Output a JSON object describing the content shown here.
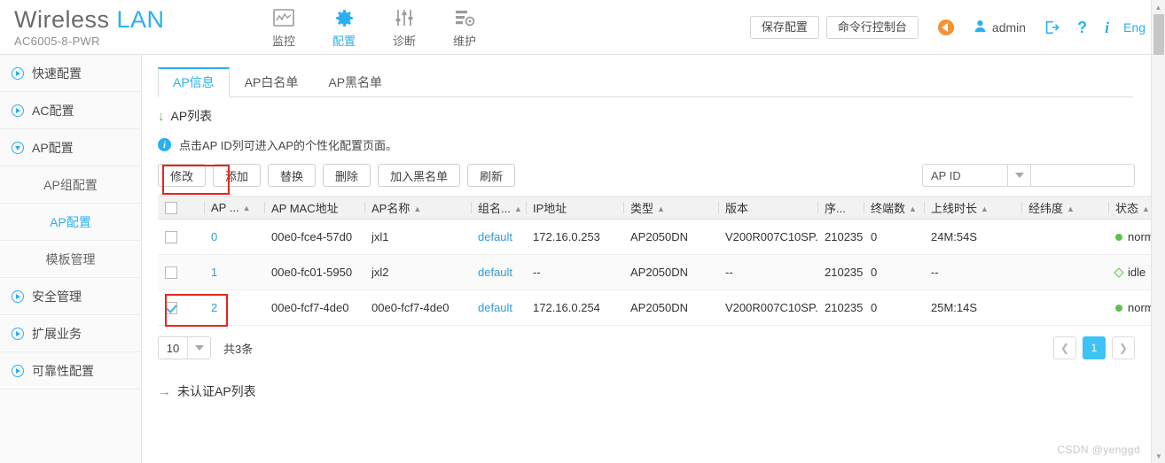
{
  "header": {
    "brand_main": "Wireless",
    "brand_accent": "LAN",
    "brand_sub": "AC6005-8-PWR",
    "nav": [
      {
        "label": "监控",
        "icon": "monitor-chart-icon",
        "active": false
      },
      {
        "label": "配置",
        "icon": "gear-icon",
        "active": true
      },
      {
        "label": "诊断",
        "icon": "sliders-icon",
        "active": false
      },
      {
        "label": "维护",
        "icon": "server-gear-icon",
        "active": false
      }
    ],
    "save_config_label": "保存配置",
    "cli_console_label": "命令行控制台",
    "alarm_icon": "alarm-megaphone-icon",
    "user_icon": "user-icon",
    "user_name": "admin",
    "logout_icon": "logout-icon",
    "help_icon": "question-mark-icon",
    "info_icon": "info-icon",
    "language_label": "Eng"
  },
  "sidebar": {
    "items": [
      {
        "label": "快速配置",
        "type": "group",
        "expanded": false,
        "active": false
      },
      {
        "label": "AC配置",
        "type": "group",
        "expanded": false,
        "active": false
      },
      {
        "label": "AP配置",
        "type": "group",
        "expanded": true,
        "active": false
      },
      {
        "label": "AP组配置",
        "type": "sub",
        "active": false
      },
      {
        "label": "AP配置",
        "type": "sub",
        "active": true
      },
      {
        "label": "模板管理",
        "type": "sub",
        "active": false
      },
      {
        "label": "安全管理",
        "type": "group",
        "expanded": false,
        "active": false
      },
      {
        "label": "扩展业务",
        "type": "group",
        "expanded": false,
        "active": false
      },
      {
        "label": "可靠性配置",
        "type": "group",
        "expanded": false,
        "active": false
      }
    ]
  },
  "main": {
    "tabs": [
      {
        "label": "AP信息",
        "active": true
      },
      {
        "label": "AP白名单",
        "active": false
      },
      {
        "label": "AP黑名单",
        "active": false
      }
    ],
    "section_title": "AP列表",
    "info_message": "点击AP ID列可进入AP的个性化配置页面。",
    "toolbar": [
      {
        "label": "修改",
        "highlighted": true
      },
      {
        "label": "添加",
        "highlighted": false
      },
      {
        "label": "替换",
        "highlighted": false
      },
      {
        "label": "删除",
        "highlighted": false
      },
      {
        "label": "加入黑名单",
        "highlighted": false
      },
      {
        "label": "刷新",
        "highlighted": false
      }
    ],
    "search": {
      "selected_field": "AP ID",
      "input_value": "",
      "placeholder": ""
    },
    "table": {
      "columns": [
        {
          "label": "",
          "sortable": false,
          "key": "check"
        },
        {
          "label": "AP ...",
          "sortable": true,
          "key": "ap_id"
        },
        {
          "label": "AP MAC地址",
          "sortable": false,
          "key": "mac"
        },
        {
          "label": "AP名称",
          "sortable": true,
          "key": "name"
        },
        {
          "label": "组名...",
          "sortable": true,
          "key": "group"
        },
        {
          "label": "IP地址",
          "sortable": false,
          "key": "ip"
        },
        {
          "label": "类型",
          "sortable": true,
          "key": "type"
        },
        {
          "label": "版本",
          "sortable": false,
          "key": "version"
        },
        {
          "label": "序...",
          "sortable": false,
          "key": "serial"
        },
        {
          "label": "终端数",
          "sortable": true,
          "key": "clients"
        },
        {
          "label": "上线时长",
          "sortable": true,
          "key": "uptime"
        },
        {
          "label": "经纬度",
          "sortable": true,
          "key": "latlon"
        },
        {
          "label": "状态",
          "sortable": true,
          "key": "status"
        }
      ],
      "rows": [
        {
          "checked": false,
          "ap_id": "0",
          "mac": "00e0-fce4-57d0",
          "name": "jxl1",
          "group": "default",
          "ip": "172.16.0.253",
          "type": "AP2050DN",
          "version": "V200R007C10SP...",
          "serial": "210235...",
          "clients": "0",
          "uptime": "24M:54S",
          "latlon": "",
          "status": "normal",
          "status_kind": "normal"
        },
        {
          "checked": false,
          "ap_id": "1",
          "mac": "00e0-fc01-5950",
          "name": "jxl2",
          "group": "default",
          "ip": "--",
          "type": "AP2050DN",
          "version": "--",
          "serial": "210235...",
          "clients": "0",
          "uptime": "--",
          "latlon": "",
          "status": "idle",
          "status_kind": "idle"
        },
        {
          "checked": true,
          "ap_id": "2",
          "mac": "00e0-fcf7-4de0",
          "name": "00e0-fcf7-4de0",
          "group": "default",
          "ip": "172.16.0.254",
          "type": "AP2050DN",
          "version": "V200R007C10SP...",
          "serial": "210235...",
          "clients": "0",
          "uptime": "25M:14S",
          "latlon": "",
          "status": "normal",
          "status_kind": "normal"
        }
      ]
    },
    "page_size": "10",
    "total_label": "共3条",
    "pagination": {
      "prev_icon": "chevron-left-icon",
      "current_page": "1",
      "next_icon": "chevron-right-icon"
    },
    "unauth_link": "未认证AP列表"
  },
  "watermark": "CSDN @yenggd",
  "colors": {
    "accent": "#2ab0ef",
    "annotation": "#e8261c",
    "status_normal": "#5ec24c",
    "status_idle": "#5ec24c",
    "alarm": "#f79232"
  }
}
